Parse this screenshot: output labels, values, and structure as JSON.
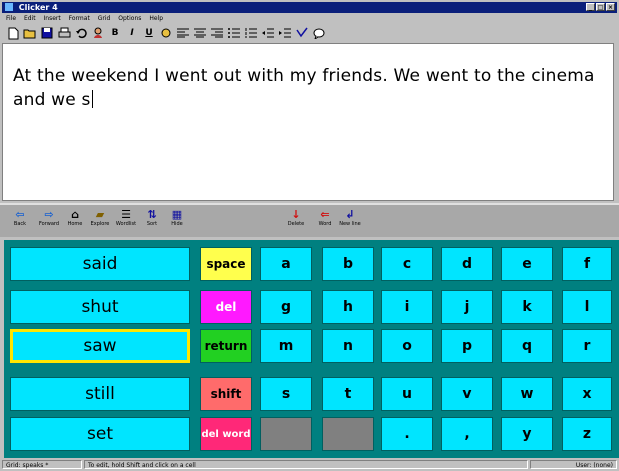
{
  "window": {
    "title": "Clicker 4"
  },
  "menu": [
    "File",
    "Edit",
    "Insert",
    "Format",
    "Grid",
    "Options",
    "Help"
  ],
  "toolbar": {
    "bold": "B",
    "italic": "I",
    "underline": "U"
  },
  "document": {
    "text": "At the weekend I went out with my friends.  We went to the cinema and we s"
  },
  "nav": [
    {
      "label": "Back",
      "icon": "arrow-left-icon"
    },
    {
      "label": "Forward",
      "icon": "arrow-right-icon"
    },
    {
      "label": "Home",
      "icon": "home-icon"
    },
    {
      "label": "Explore",
      "icon": "explore-icon"
    },
    {
      "label": "Wordlist",
      "icon": "wordlist-icon"
    },
    {
      "label": "Sort",
      "icon": "sort-icon"
    },
    {
      "label": "Hide",
      "icon": "hide-icon"
    },
    {
      "label": "Delete",
      "icon": "delete-icon"
    },
    {
      "label": "Word",
      "icon": "delete-word-icon"
    },
    {
      "label": "New line",
      "icon": "new-line-icon"
    }
  ],
  "keys": {
    "words": [
      "said",
      "shut",
      "saw",
      "still",
      "set"
    ],
    "controls": [
      {
        "label": "space",
        "color": "#ffff4d"
      },
      {
        "label": "del",
        "color": "#ff19ff"
      },
      {
        "label": "return",
        "color": "#22d022"
      },
      {
        "label": "shift",
        "color": "#ff6b6b"
      },
      {
        "label": "del word",
        "color": "#ff2878"
      }
    ],
    "letters": [
      [
        "a",
        "b",
        "c",
        "d",
        "e",
        "f"
      ],
      [
        "g",
        "h",
        "i",
        "j",
        "k",
        "l"
      ],
      [
        "m",
        "n",
        "o",
        "p",
        "q",
        "r"
      ],
      [
        "s",
        "t",
        "u",
        "v",
        "w",
        "x"
      ],
      [
        "",
        "",
        ".",
        ",",
        "y",
        "z"
      ]
    ],
    "selected_word": "saw"
  },
  "status": {
    "left": "Grid: speaks *",
    "middle": "To edit, hold Shift and click on a cell",
    "right": "User: (none)"
  }
}
